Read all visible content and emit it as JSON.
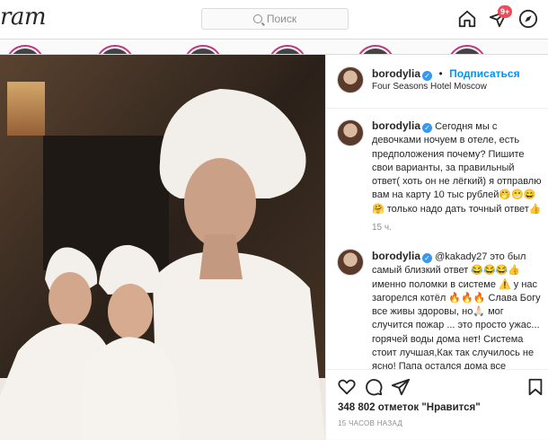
{
  "topbar": {
    "logo": "ram",
    "search_placeholder": "Поиск",
    "notification_count": "9+",
    "icons": [
      "home-icon",
      "direct-icon",
      "explore-icon"
    ]
  },
  "post": {
    "author": "borodylia",
    "follow_label": "Подписаться",
    "dot": "•",
    "location": "Four Seasons Hotel Moscow",
    "caption": "Сегодня мы с девочками ночуем в отеле, есть предположения почему? Пишите свои варианты, за правильный ответ( хоть он не лёгкий) я отправлю вам на карту 10 тыс рублей🤭😁😄🤗 только надо дать точный ответ👍",
    "caption_time": "15 ч.",
    "reply": "@kakady27 это был самый близкий ответ 😂😂😂👍 именно поломки в системе ⚠️ у нас загорелся котёл 🔥🔥🔥 Слава Богу все живы здоровы, но🙏🏻 мог случится пожар ... это просто ужас... горячей воды дома нет! Система стоит лучшая,Как так случилось не ясно! Папа остался дома все",
    "likes_text": "348 802 отметок \"Нравится\"",
    "time_ago": "15 ЧАСОВ НАЗАД"
  },
  "colors": {
    "accent": "#0095f6",
    "verified": "#3897f0",
    "notification": "#ed4956",
    "border": "#dbdbdb",
    "muted": "#8e8e8e"
  }
}
